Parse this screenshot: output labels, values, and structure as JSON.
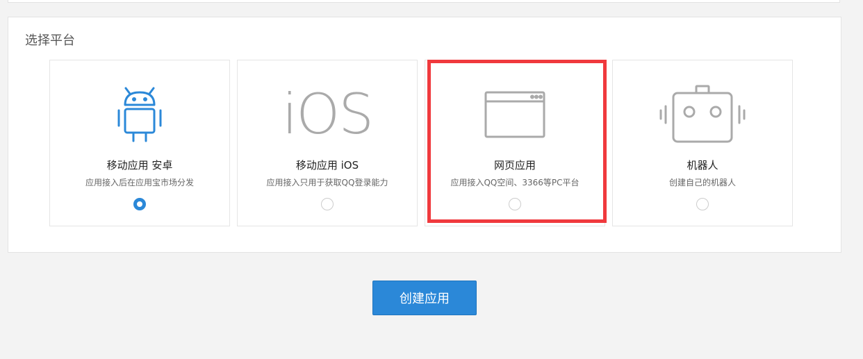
{
  "section": {
    "title": "选择平台"
  },
  "platforms": [
    {
      "name": "移动应用 安卓",
      "desc": "应用接入后在应用宝市场分发",
      "selected": true,
      "icon": "android-icon"
    },
    {
      "name": "移动应用 iOS",
      "desc": "应用接入只用于获取QQ登录能力",
      "selected": false,
      "icon": "ios-icon",
      "icon_text": "iOS"
    },
    {
      "name": "网页应用",
      "desc": "应用接入QQ空间、3366等PC平台",
      "selected": false,
      "icon": "browser-window-icon"
    },
    {
      "name": "机器人",
      "desc": "创建自己的机器人",
      "selected": false,
      "icon": "robot-icon"
    }
  ],
  "actions": {
    "create_label": "创建应用"
  },
  "colors": {
    "accent": "#2b88d8",
    "highlight": "#f0393d",
    "icon_gray": "#aaaaaa"
  }
}
